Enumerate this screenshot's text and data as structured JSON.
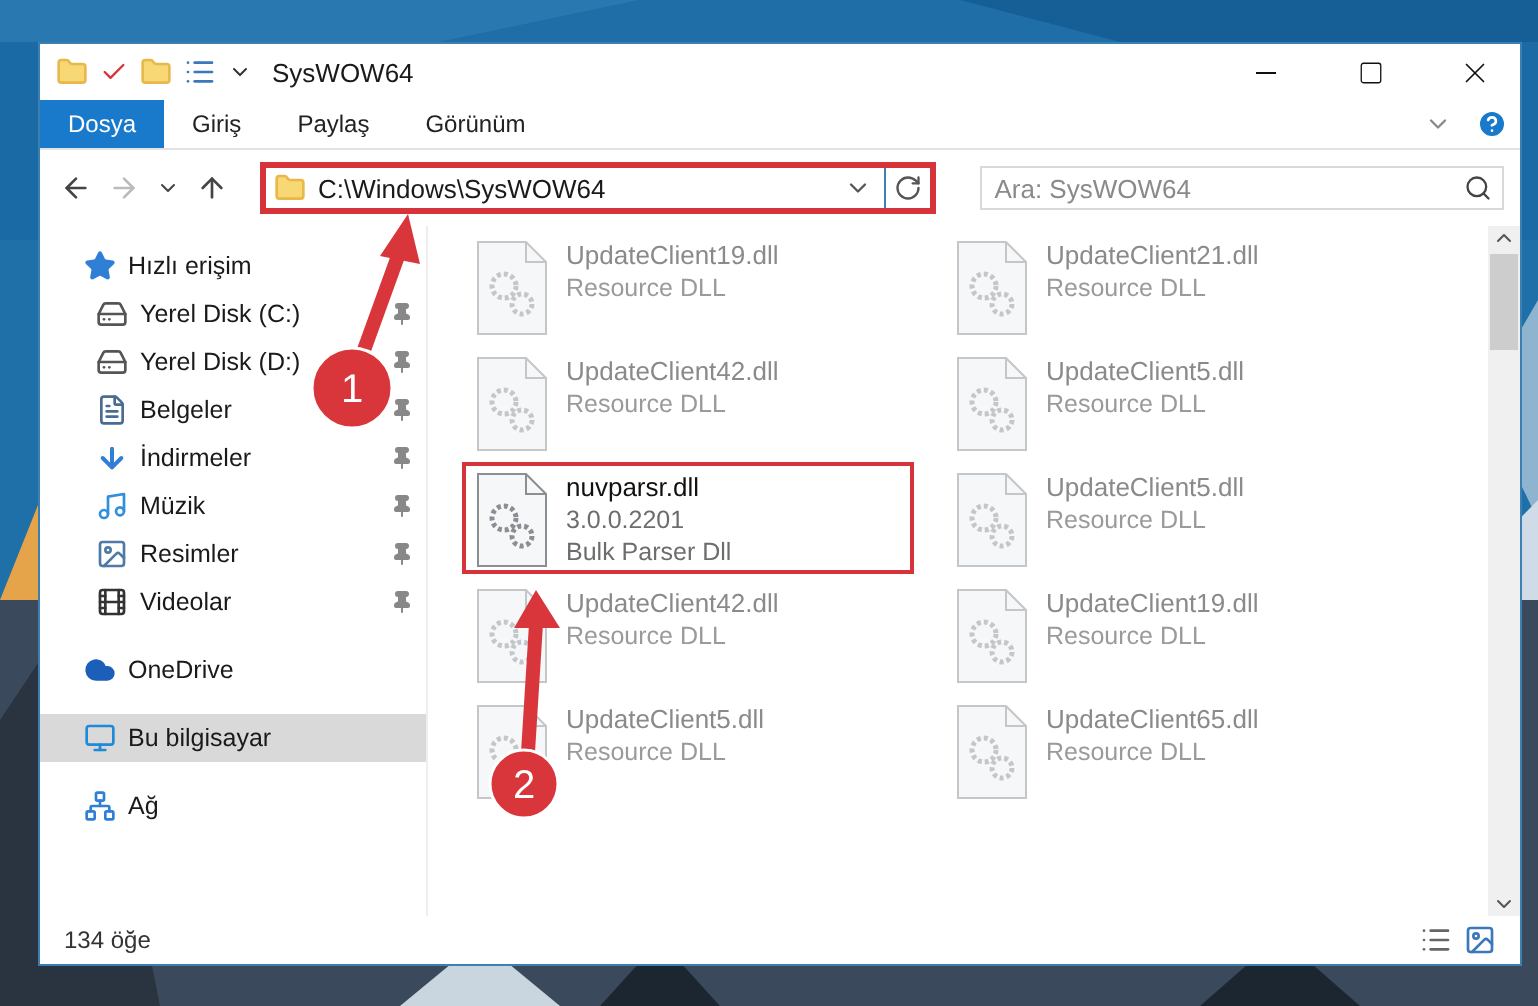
{
  "window": {
    "title": "SysWOW64"
  },
  "ribbon_tabs": [
    {
      "label": "Dosya",
      "selected": true
    },
    {
      "label": "Giriş",
      "selected": false
    },
    {
      "label": "Paylaş",
      "selected": false
    },
    {
      "label": "Görünüm",
      "selected": false
    }
  ],
  "address": {
    "value": "C:\\Windows\\SysWOW64",
    "highlighted": true
  },
  "search": {
    "placeholder": "Ara: SysWOW64"
  },
  "nav_pane": [
    {
      "label": "Hızlı erişim",
      "kind": "star",
      "selected": false,
      "children": [
        {
          "label": "Yerel Disk (C:)",
          "kind": "disk",
          "pinned": true,
          "selected": false
        },
        {
          "label": "Yerel Disk (D:)",
          "kind": "disk",
          "pinned": true,
          "selected": false
        },
        {
          "label": "Belgeler",
          "kind": "docs",
          "pinned": true,
          "selected": false
        },
        {
          "label": "İndirmeler",
          "kind": "download",
          "pinned": true,
          "selected": false
        },
        {
          "label": "Müzik",
          "kind": "music",
          "pinned": true,
          "selected": false
        },
        {
          "label": "Resimler",
          "kind": "pictures",
          "pinned": true,
          "selected": false
        },
        {
          "label": "Videolar",
          "kind": "videos",
          "pinned": true,
          "selected": false
        }
      ]
    },
    {
      "label": "OneDrive",
      "kind": "cloud",
      "selected": false
    },
    {
      "label": "Bu bilgisayar",
      "kind": "pc",
      "selected": true
    },
    {
      "label": "Ağ",
      "kind": "network",
      "selected": false
    }
  ],
  "files": [
    {
      "name": "UpdateClient19.dll",
      "line_2": "Resource DLL",
      "dimmed": true,
      "highlighted": false
    },
    {
      "name": "UpdateClient21.dll",
      "line_2": "Resource DLL",
      "dimmed": true,
      "highlighted": false
    },
    {
      "name": "UpdateClient42.dll",
      "line_2": "Resource DLL",
      "dimmed": true,
      "highlighted": false
    },
    {
      "name": "UpdateClient5.dll",
      "line_2": "Resource DLL",
      "dimmed": true,
      "highlighted": false
    },
    {
      "name": "nuvparsr.dll",
      "line_2": "3.0.0.2201",
      "line_3": "Bulk Parser Dll",
      "dimmed": false,
      "highlighted": true
    },
    {
      "name": "UpdateClient5.dll",
      "line_2": "Resource DLL",
      "dimmed": true,
      "highlighted": false
    },
    {
      "name": "UpdateClient42.dll",
      "line_2": "Resource DLL",
      "dimmed": true,
      "highlighted": false
    },
    {
      "name": "UpdateClient19.dll",
      "line_2": "Resource DLL",
      "dimmed": true,
      "highlighted": false
    },
    {
      "name": "UpdateClient5.dll",
      "line_2": "Resource DLL",
      "dimmed": true,
      "highlighted": false
    },
    {
      "name": "UpdateClient65.dll",
      "line_2": "Resource DLL",
      "dimmed": true,
      "highlighted": false
    }
  ],
  "status_bar": {
    "item_count": "134 öğe"
  },
  "callouts": [
    {
      "label": "1"
    },
    {
      "label": "2"
    }
  ]
}
